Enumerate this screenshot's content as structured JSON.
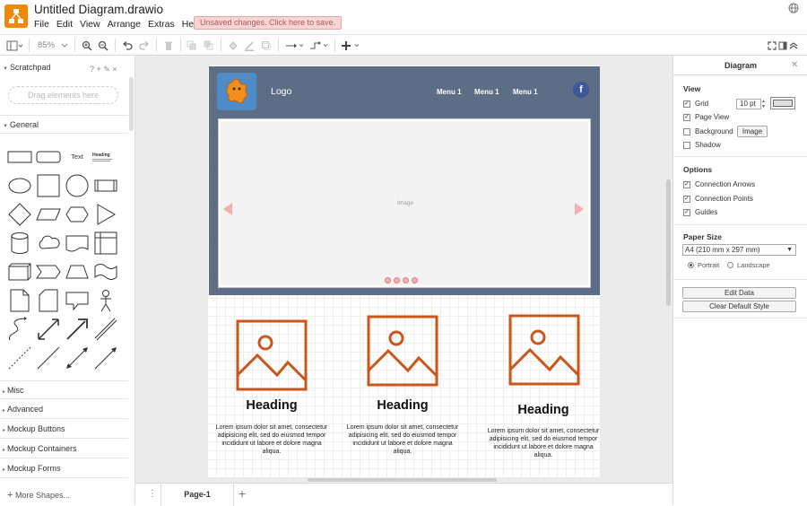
{
  "app": {
    "title": "Untitled Diagram.drawio",
    "unsaved_notice": "Unsaved changes. Click here to save.",
    "brand_color": "#f08705"
  },
  "menus": [
    "File",
    "Edit",
    "View",
    "Arrange",
    "Extras",
    "Help"
  ],
  "toolbar": {
    "zoom": "85%"
  },
  "sidebar": {
    "scratchpad_label": "Scratchpad",
    "scratchpad_tools": "? + ✎ ×",
    "drag_placeholder": "Drag elements here",
    "general_label": "General",
    "text_shape": "Text",
    "heading_shape": "Heading",
    "sections": [
      "Misc",
      "Advanced",
      "Mockup Buttons",
      "Mockup Containers",
      "Mockup Forms"
    ],
    "more_shapes": "More Shapes..."
  },
  "mockup": {
    "logo": "Logo",
    "menu_items": [
      "Menu 1",
      "Menu 1",
      "Menu 1"
    ],
    "facebook_glyph": "f",
    "carousel_label": "Image",
    "cards": [
      {
        "heading": "Heading",
        "text": "Lorem ipsum dolor sit amet, consectetur adipisicing elit, sed do eiusmod tempor incididunt ut labore et dolore magna aliqua."
      },
      {
        "heading": "Heading",
        "text": "Lorem ipsum dolor sit amet, consectetur adipisicing elit, sed do eiusmod tempor incididunt ut labore et dolore magna aliqua."
      },
      {
        "heading": "Heading",
        "text": "Lorem ipsum dolor sit amet, consectetur adipisicing elit, sed do eiusmod tempor incididunt ut labore et dolore magna aliqua."
      }
    ],
    "header_color": "#5d6d85",
    "icon_color": "#c9561a"
  },
  "pages": {
    "current": "Page-1"
  },
  "format_panel": {
    "title": "Diagram",
    "view_label": "View",
    "grid": {
      "label": "Grid",
      "checked": true,
      "size": "10 pt"
    },
    "page_view": {
      "label": "Page View",
      "checked": true
    },
    "background": {
      "label": "Background",
      "checked": false,
      "button": "Image"
    },
    "shadow": {
      "label": "Shadow",
      "checked": false
    },
    "options_label": "Options",
    "options": [
      {
        "label": "Connection Arrows",
        "checked": true
      },
      {
        "label": "Connection Points",
        "checked": true
      },
      {
        "label": "Guides",
        "checked": true
      }
    ],
    "paper_size_label": "Paper Size",
    "paper_size": "A4 (210 mm x 297 mm)",
    "orientation": {
      "portrait": "Portrait",
      "landscape": "Landscape",
      "selected": "portrait"
    },
    "edit_data": "Edit Data",
    "clear_style": "Clear Default Style"
  }
}
